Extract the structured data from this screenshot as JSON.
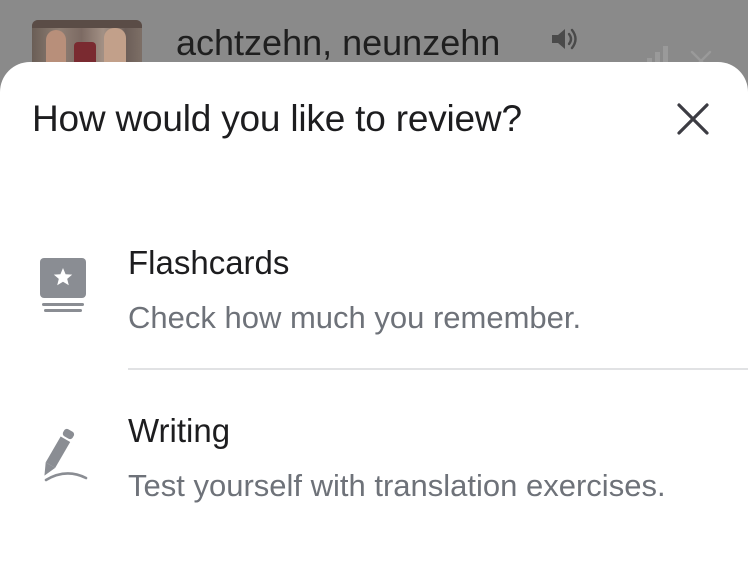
{
  "background": {
    "word": "achtzehn, neunzehn",
    "speaker_icon": "speaker-icon",
    "bars_icon": "bar-chart-icon",
    "close_icon": "close-icon"
  },
  "sheet": {
    "title": "How would you like to review?",
    "close_icon": "close-icon",
    "options": [
      {
        "icon": "flashcard-star-icon",
        "title": "Flashcards",
        "description": "Check how much you remember."
      },
      {
        "icon": "pencil-icon",
        "title": "Writing",
        "description": "Test yourself with translation exercises."
      }
    ]
  },
  "colors": {
    "overlay": "#8e8e8e",
    "sheet_background": "#ffffff",
    "title_text": "#1d1d1f",
    "secondary_text": "#6e7279",
    "icon_gray": "#8a8d93",
    "divider": "#e1e2e4"
  }
}
